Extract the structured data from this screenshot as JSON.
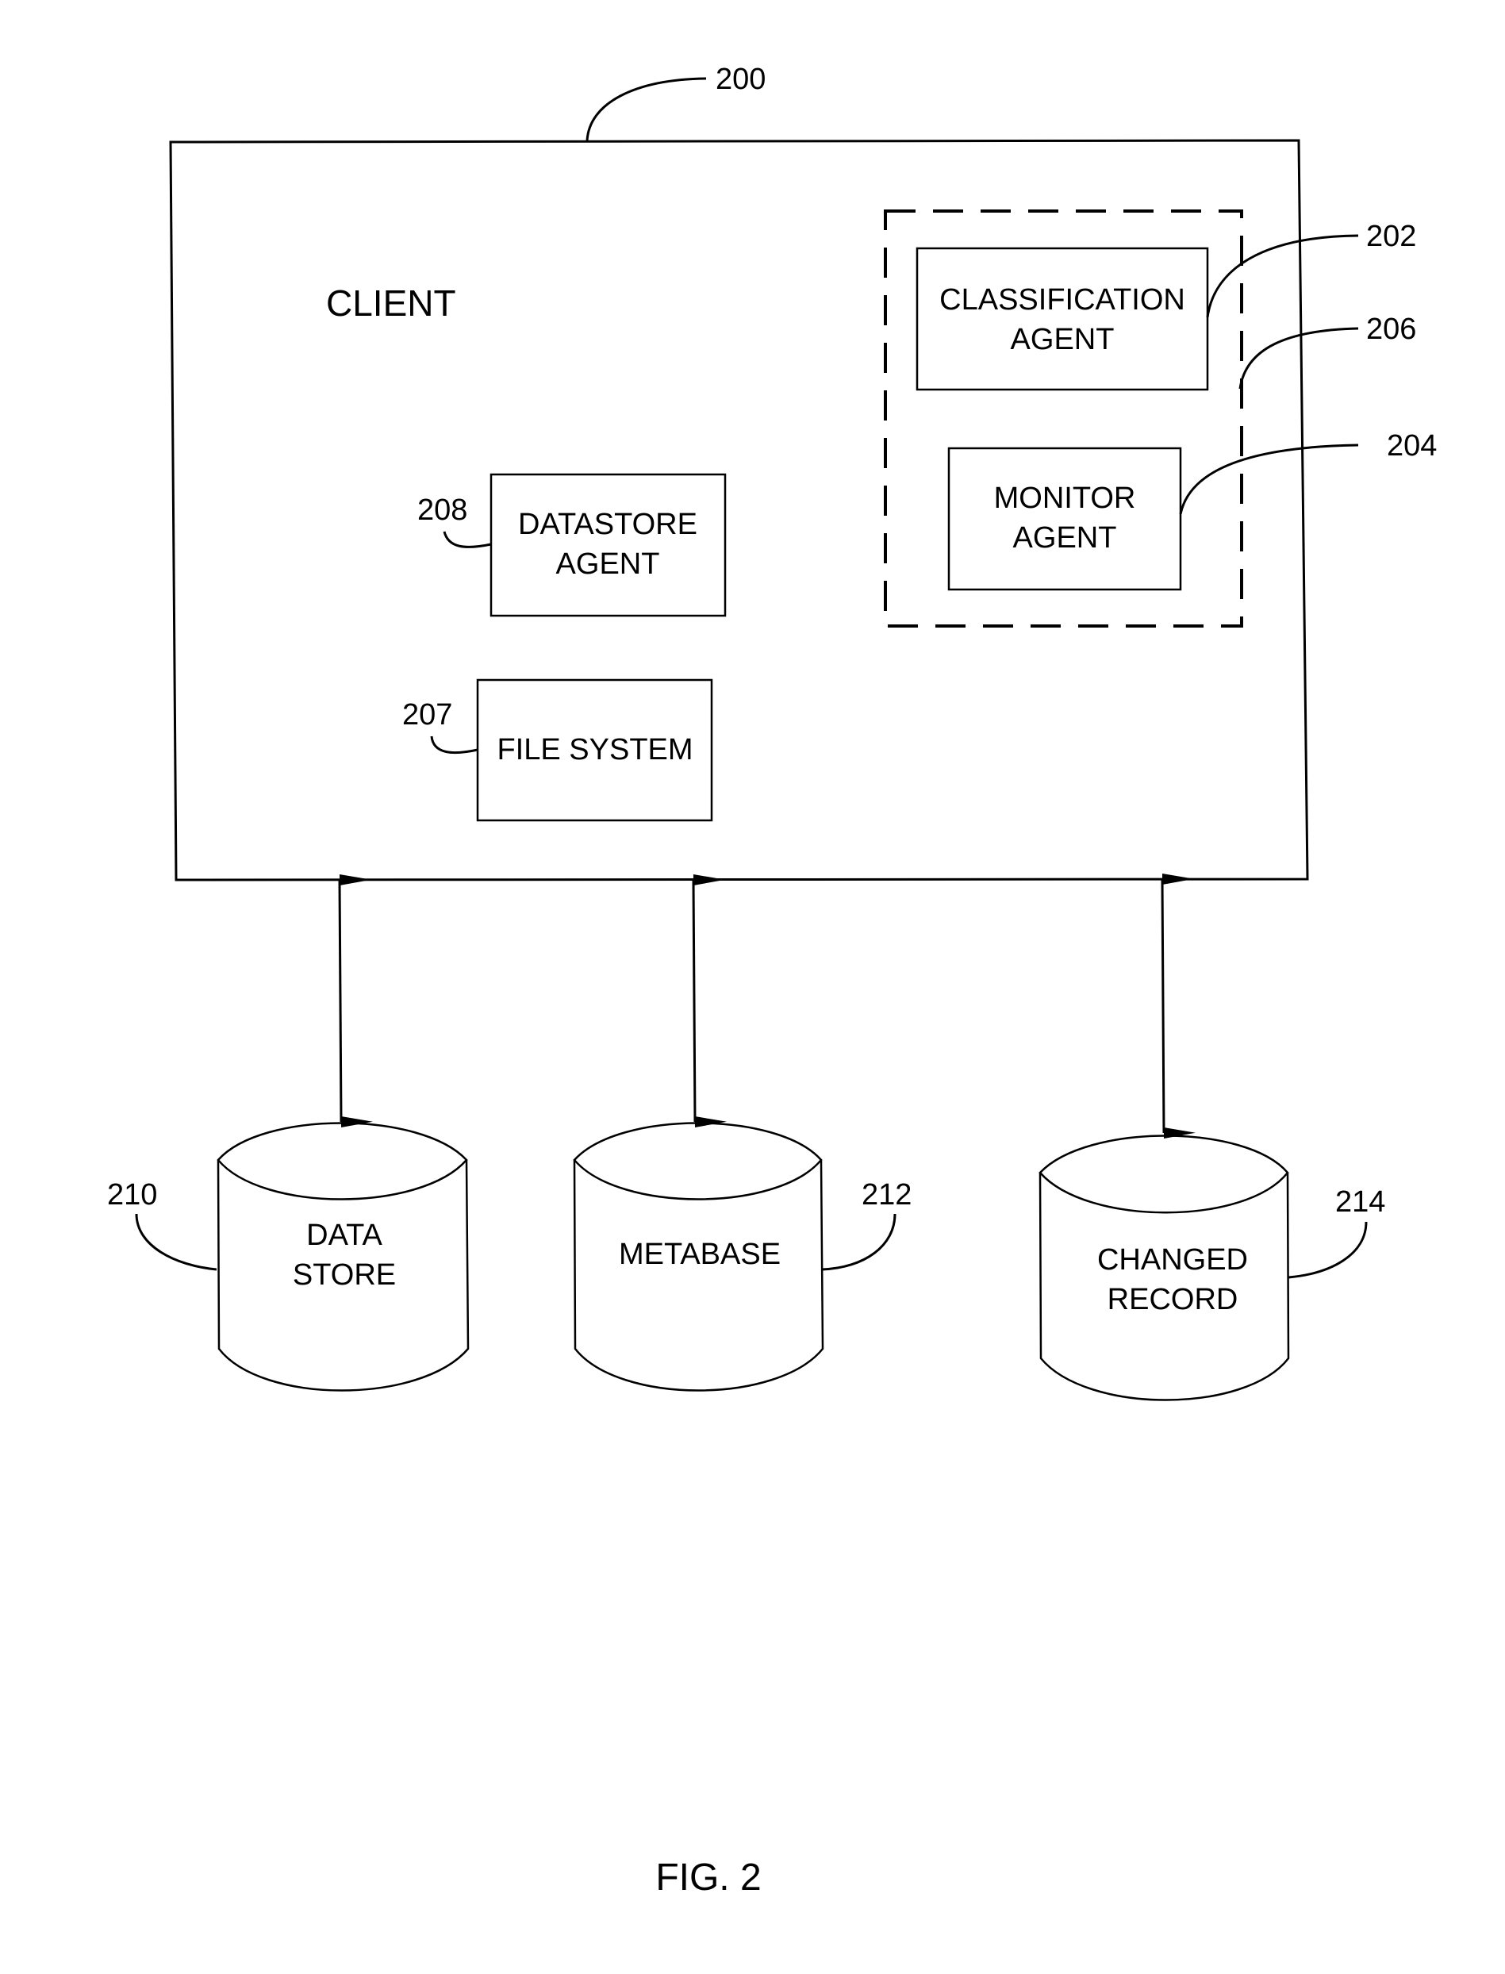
{
  "figure": {
    "caption": "FIG. 2",
    "client": {
      "label": "CLIENT",
      "ref": "200"
    },
    "group": {
      "ref": "206"
    },
    "components": [
      {
        "id": "classification",
        "lines": [
          "CLASSIFICATION",
          "AGENT"
        ],
        "ref": "202"
      },
      {
        "id": "monitor",
        "lines": [
          "MONITOR",
          "AGENT"
        ],
        "ref": "204"
      },
      {
        "id": "datastore-agent",
        "lines": [
          "DATASTORE",
          "AGENT"
        ],
        "ref": "208"
      },
      {
        "id": "file-system",
        "lines": [
          "FILE SYSTEM"
        ],
        "ref": "207"
      }
    ],
    "stores": [
      {
        "id": "data-store",
        "lines": [
          "DATA",
          "STORE"
        ],
        "ref": "210"
      },
      {
        "id": "metabase",
        "lines": [
          "METABASE"
        ],
        "ref": "212"
      },
      {
        "id": "changed-record",
        "lines": [
          "CHANGED",
          "RECORD"
        ],
        "ref": "214"
      }
    ],
    "connections": [
      {
        "from": "client",
        "to": "data-store",
        "direction": "bidirectional"
      },
      {
        "from": "client",
        "to": "metabase",
        "direction": "bidirectional"
      },
      {
        "from": "client",
        "to": "changed-record",
        "direction": "bidirectional"
      }
    ]
  }
}
